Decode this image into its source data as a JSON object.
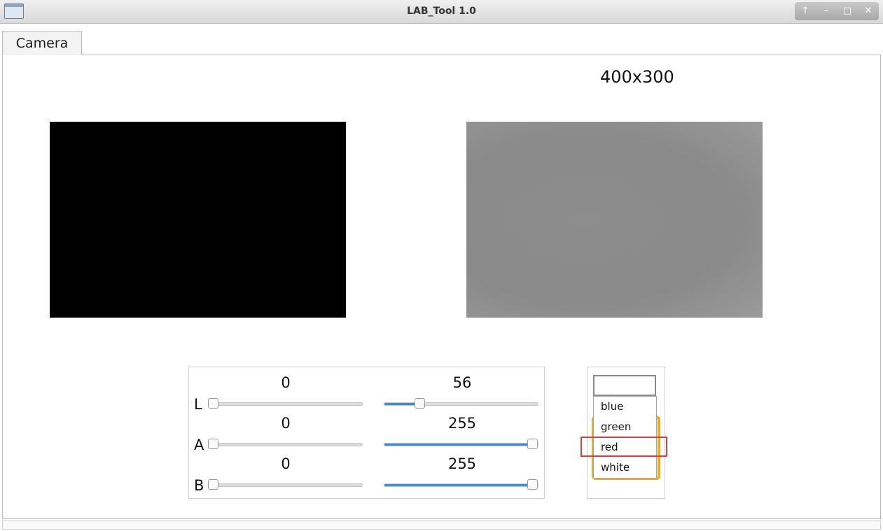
{
  "window": {
    "title": "LAB_Tool 1.0"
  },
  "tabs": [
    {
      "label": "Camera"
    }
  ],
  "camera": {
    "resolution_label": "400x300"
  },
  "sliders": {
    "L": {
      "label": "L",
      "min_value": "0",
      "max_value": "56",
      "min_fraction": 0.0,
      "max_fraction": 0.22
    },
    "A": {
      "label": "A",
      "min_value": "0",
      "max_value": "255",
      "min_fraction": 0.0,
      "max_fraction": 1.0
    },
    "B": {
      "label": "B",
      "min_value": "0",
      "max_value": "255",
      "min_fraction": 0.0,
      "max_fraction": 1.0
    }
  },
  "color_list": {
    "input_value": "",
    "items": [
      "blue",
      "green",
      "red",
      "white"
    ],
    "highlighted": "red"
  },
  "colors": {
    "slider_fill": "#3b8fd6",
    "highlight_border": "#e23b3b",
    "orange_frame": "#f5a623"
  }
}
